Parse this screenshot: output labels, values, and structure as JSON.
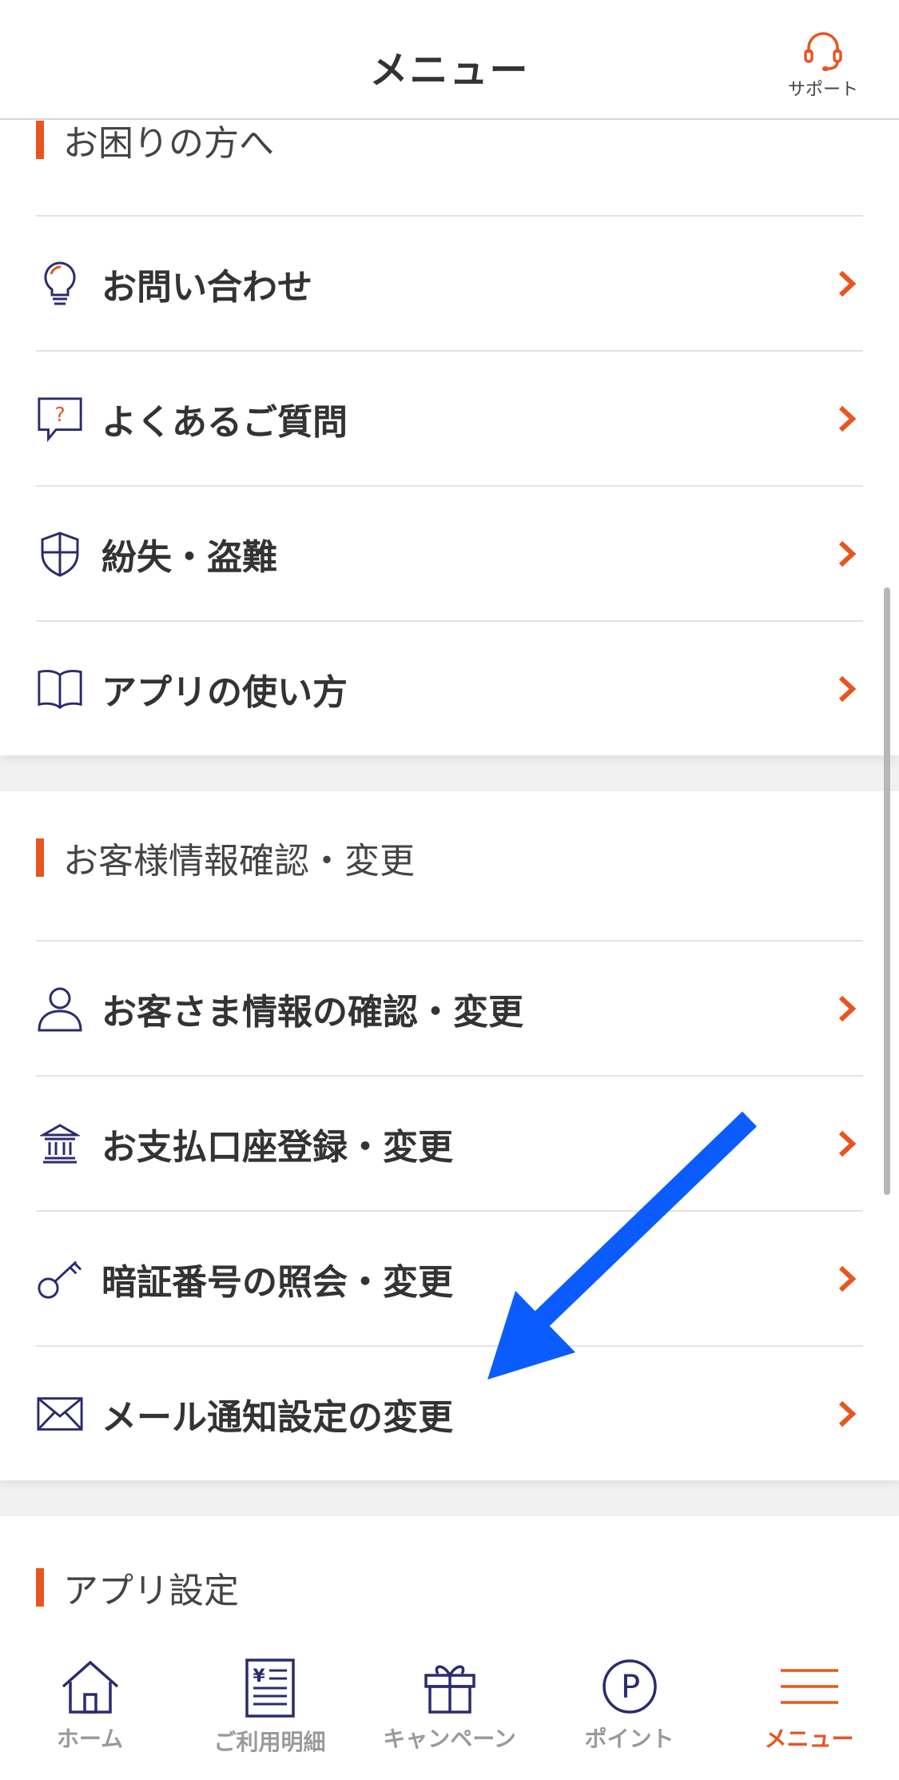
{
  "header": {
    "title": "メニュー",
    "support_label": "サポート"
  },
  "sections": [
    {
      "title": "お困りの方へ",
      "items": [
        {
          "label": "お問い合わせ",
          "icon": "lightbulb-icon"
        },
        {
          "label": "よくあるご質問",
          "icon": "question-bubble-icon"
        },
        {
          "label": "紛失・盗難",
          "icon": "shield-icon"
        },
        {
          "label": "アプリの使い方",
          "icon": "book-icon"
        }
      ]
    },
    {
      "title": "お客様情報確認・変更",
      "items": [
        {
          "label": "お客さま情報の確認・変更",
          "icon": "person-icon"
        },
        {
          "label": "お支払口座登録・変更",
          "icon": "bank-icon"
        },
        {
          "label": "暗証番号の照会・変更",
          "icon": "key-icon"
        },
        {
          "label": "メール通知設定の変更",
          "icon": "mail-icon"
        }
      ]
    },
    {
      "title": "アプリ設定",
      "items": []
    }
  ],
  "tabs": [
    {
      "label": "ホーム",
      "icon": "home-icon",
      "active": false
    },
    {
      "label": "ご利用明細",
      "icon": "statement-icon",
      "active": false
    },
    {
      "label": "キャンペーン",
      "icon": "gift-icon",
      "active": false
    },
    {
      "label": "ポイント",
      "icon": "point-icon",
      "active": false
    },
    {
      "label": "メニュー",
      "icon": "menu-icon",
      "active": true
    }
  ],
  "colors": {
    "accent": "#e85520",
    "icon_navy": "#2b2b6e",
    "annotation_arrow": "#0a5cff"
  }
}
